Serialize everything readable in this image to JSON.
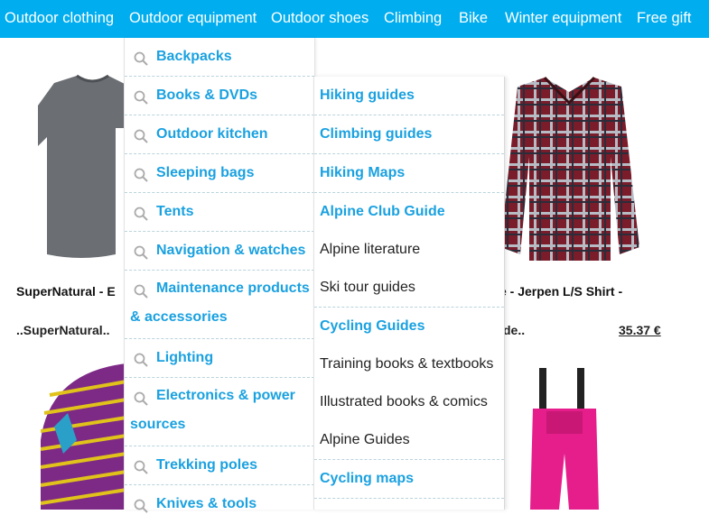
{
  "topnav": {
    "items": [
      "Outdoor clothing",
      "Outdoor equipment",
      "Outdoor shoes",
      "Climbing",
      "Bike",
      "Winter equipment",
      "Free gift"
    ]
  },
  "products": {
    "left_name": "SuperNatural - E",
    "left_sub": "..SuperNatural..",
    "right_name": "e - Jerpen L/S Shirt -",
    "right_sub": "de..",
    "right_price": "35.37 €"
  },
  "dropdown": {
    "items": [
      "Backpacks",
      "Books & DVDs",
      "Outdoor kitchen",
      "Sleeping bags",
      "Tents",
      "Navigation & watches",
      "Maintenance products & accessories",
      "Lighting",
      "Electronics & power sources",
      "Trekking poles",
      "Knives & tools"
    ]
  },
  "submenu": {
    "items": [
      "Hiking guides",
      "Climbing guides",
      "Hiking Maps",
      "Alpine Club Guide",
      "Alpine literature",
      "Ski tour guides",
      "Cycling Guides",
      "Training books & textbooks",
      "Illustrated books & comics",
      "Alpine Guides",
      "Cycling maps"
    ]
  },
  "colors": {
    "nav_bg": "#00adef",
    "link": "#1aa1e0"
  }
}
